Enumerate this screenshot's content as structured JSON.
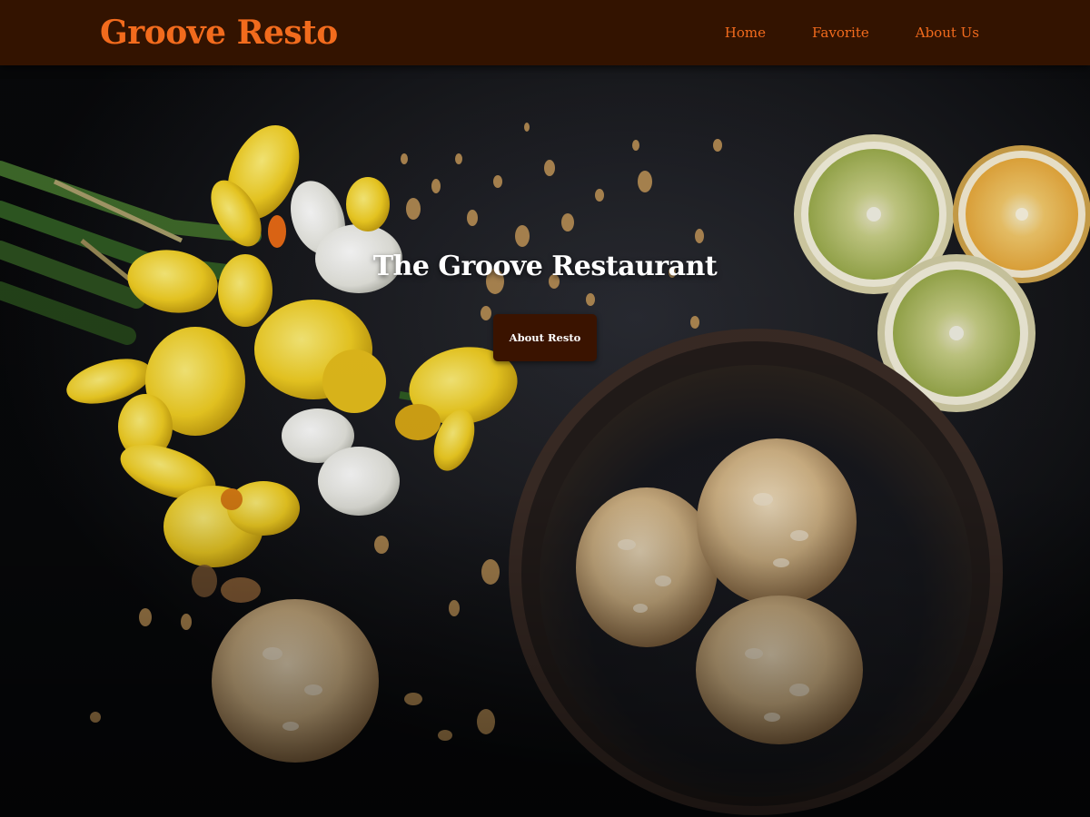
{
  "navbar": {
    "brand": "Groove Resto",
    "links": [
      {
        "label": "Home"
      },
      {
        "label": "Favorite"
      },
      {
        "label": "About Us"
      }
    ]
  },
  "hero": {
    "title": "The Groove Restaurant",
    "button_label": "About Resto"
  },
  "colors": {
    "navbar_bg": "#331300",
    "accent": "#f26b1d",
    "button_bg": "#3a1300",
    "title": "#ffffff"
  }
}
